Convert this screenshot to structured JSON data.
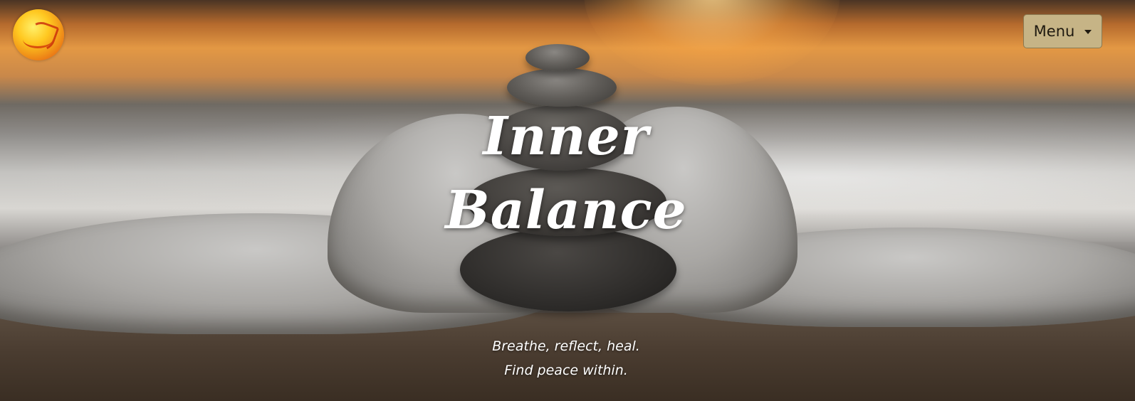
{
  "header": {
    "logo_name": "phoenix-logo",
    "menu_label": "Menu"
  },
  "hero": {
    "title_line1": "Inner",
    "title_line2": "Balance",
    "tagline_line1": "Breathe, reflect, heal.",
    "tagline_line2": "Find peace within."
  },
  "colors": {
    "menu_bg": "#c6b486",
    "text": "#ffffff"
  }
}
